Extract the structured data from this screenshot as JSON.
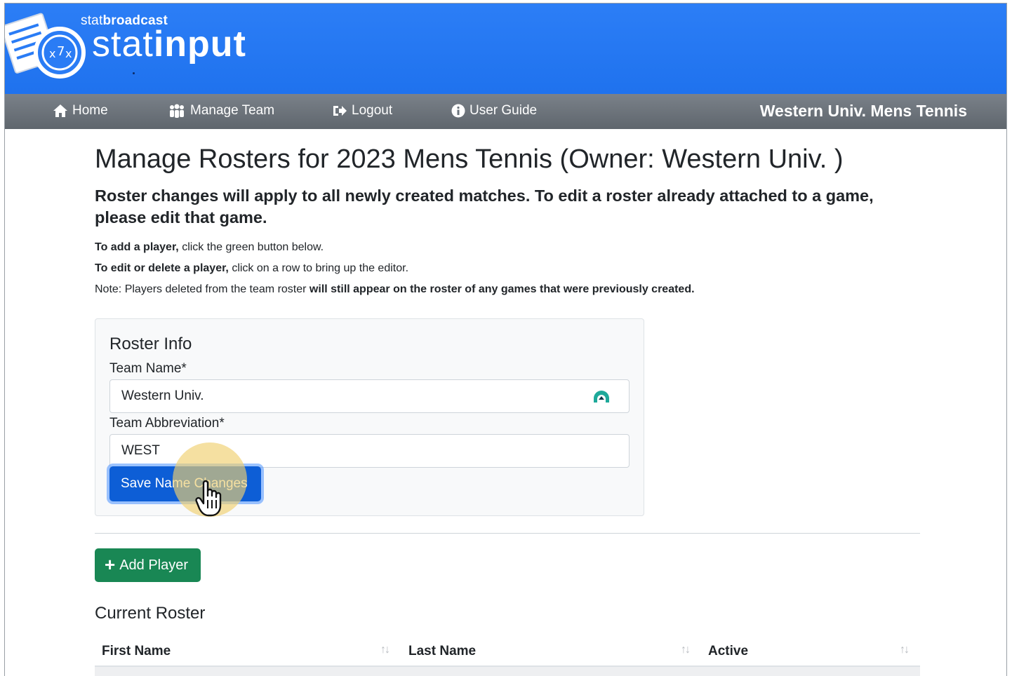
{
  "header": {
    "brand_prefix": "stat",
    "brand_prefix_bold": "broadcast",
    "brand_main": "stat",
    "brand_main_bold": "input"
  },
  "nav": {
    "items": [
      {
        "label": "Home",
        "icon": "home-icon"
      },
      {
        "label": "Manage Team",
        "icon": "users-icon"
      },
      {
        "label": "Logout",
        "icon": "logout-icon"
      },
      {
        "label": "User Guide",
        "icon": "info-icon"
      }
    ],
    "team_name": "Western Univ. Mens Tennis"
  },
  "main": {
    "title": "Manage Rosters for 2023 Mens Tennis (Owner: Western Univ. )",
    "subtitle": "Roster changes will apply to all newly created matches. To edit a roster already attached to a game, please edit that game.",
    "note1_bold": "To add a player,",
    "note1_rest": " click the green button below.",
    "note2_bold": "To edit or delete a player,",
    "note2_rest": " click on a row to bring up the editor.",
    "note3_start": "Note: Players deleted from the team roster ",
    "note3_bold": "will still appear on the roster of any games that were previously created."
  },
  "roster_info": {
    "title": "Roster Info",
    "team_name_label": "Team Name*",
    "team_name_value": "Western Univ.",
    "abbrev_label": "Team Abbreviation*",
    "abbrev_value": "WEST",
    "save_label": "Save Name Changes"
  },
  "roster": {
    "add_label": "Add Player",
    "section_title": "Current Roster",
    "columns": [
      "First Name",
      "Last Name",
      "Active"
    ],
    "sort_glyph": "↑↓"
  },
  "colors": {
    "header_blue": "#2a7cf5",
    "nav_gray": "#6c757d",
    "save_blue": "#0d5ed6",
    "add_green": "#198754"
  }
}
